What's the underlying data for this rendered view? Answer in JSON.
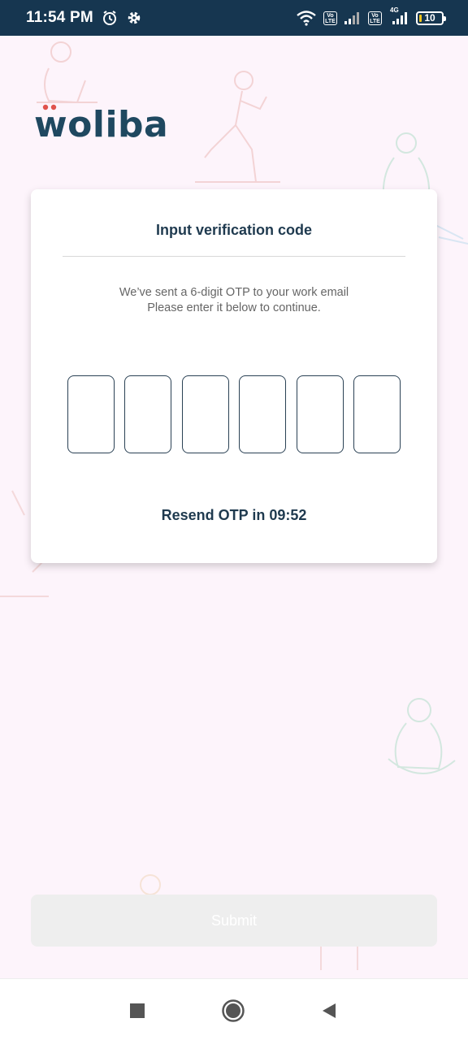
{
  "status_bar": {
    "time": "11:54 PM",
    "network_label": "4G",
    "battery_level": "10",
    "icons": [
      "alarm-icon",
      "gear-icon",
      "wifi-icon",
      "volte-icon",
      "signal-icon",
      "battery-icon"
    ],
    "volte_text": "Vo\nLTE"
  },
  "brand": {
    "logo_text": "woliba",
    "color": "#1f4860",
    "accent": "#e0524c"
  },
  "card": {
    "title": "Input verification code",
    "subtitle_line1": "We’ve sent a 6-digit OTP to your work email",
    "subtitle_line2": "Please enter it below to continue.",
    "otp_digits": [
      "",
      "",
      "",
      "",
      "",
      ""
    ],
    "resend_text": "Resend OTP in 09:52"
  },
  "submit": {
    "label": "Submit",
    "enabled": false
  },
  "colors": {
    "status_bar_bg": "#163650",
    "page_bg": "#fdf4fb",
    "text_dark": "#1f3a4f"
  },
  "nav": {
    "buttons": [
      "recents-icon",
      "home-icon",
      "back-icon"
    ]
  }
}
